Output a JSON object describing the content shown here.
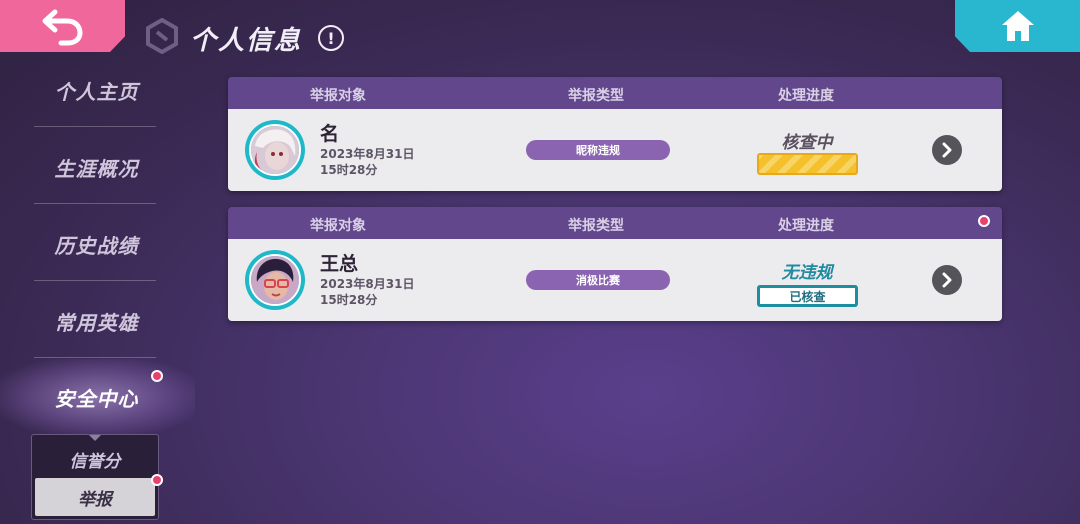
{
  "header": {
    "title": "个人信息",
    "info_symbol": "!"
  },
  "sidebar": {
    "items": [
      {
        "label": "个人主页"
      },
      {
        "label": "生涯概况"
      },
      {
        "label": "历史战绩"
      },
      {
        "label": "常用英雄"
      },
      {
        "label": "安全中心",
        "active": true
      }
    ],
    "subnav": [
      {
        "label": "信誉分"
      },
      {
        "label": "举报",
        "selected": true
      }
    ]
  },
  "columns": {
    "target": "举报对象",
    "type": "举报类型",
    "progress": "处理进度"
  },
  "reports": [
    {
      "name": "名",
      "date": "2023年8月31日",
      "time": "15时28分",
      "type": "昵称违规",
      "status": "核查中",
      "status_color": "#5a5060",
      "has_new": false
    },
    {
      "name": "王总",
      "date": "2023年8月31日",
      "time": "15时28分",
      "type": "消极比赛",
      "status": "无违规",
      "status_color": "#1f8aa0",
      "result_badge": "已核查",
      "has_new": true
    }
  ],
  "colors": {
    "back": "#f0679b",
    "home": "#29b6cf",
    "header_bar": "#62478c",
    "pill": "#8a64b0",
    "badge_dot": "#e8416e"
  },
  "icons": {
    "back": "back-arrow-icon",
    "home": "home-icon",
    "info": "info-icon",
    "logo": "game-logo-icon",
    "detail": "chevron-right-icon"
  }
}
